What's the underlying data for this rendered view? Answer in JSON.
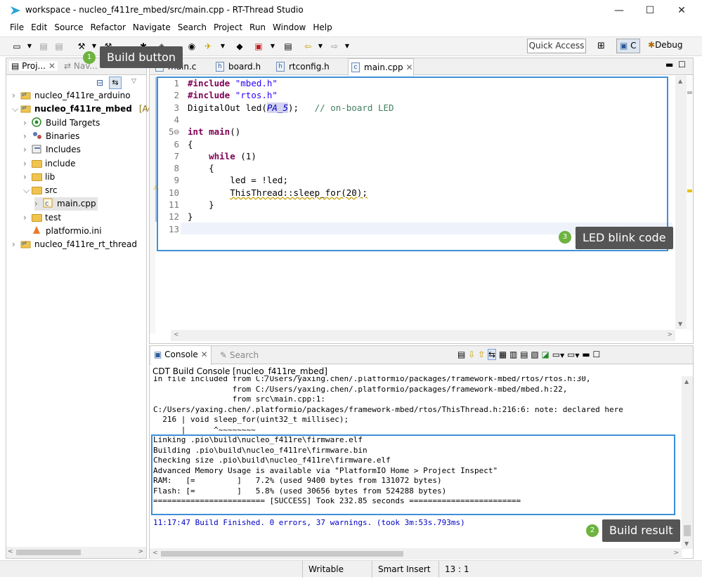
{
  "window": {
    "title": "workspace - nucleo_f411re_mbed/src/main.cpp - RT-Thread Studio",
    "minimize": "—",
    "maximize": "☐",
    "close": "✕"
  },
  "menu": [
    "File",
    "Edit",
    "Source",
    "Refactor",
    "Navigate",
    "Search",
    "Project",
    "Run",
    "Window",
    "Help"
  ],
  "toolbar": {
    "quick_access": "Quick Access",
    "perspective_c": "C",
    "perspective_debug": "Debug"
  },
  "left_panel": {
    "tab_project": "Proj...",
    "tab_navigator": "Nav...",
    "tree": [
      {
        "label": "nucleo_f411re_arduino",
        "level": 0,
        "expanded": false,
        "bold": false,
        "icon": "project-icon"
      },
      {
        "label": "nucleo_f411re_mbed",
        "level": 0,
        "expanded": true,
        "bold": true,
        "icon": "project-icon",
        "suffix": "[Ac"
      },
      {
        "label": "Build Targets",
        "level": 1,
        "expanded": false,
        "icon": "target-icon"
      },
      {
        "label": "Binaries",
        "level": 1,
        "expanded": false,
        "icon": "binaries-icon"
      },
      {
        "label": "Includes",
        "level": 1,
        "expanded": false,
        "icon": "includes-icon"
      },
      {
        "label": "include",
        "level": 1,
        "expanded": false,
        "icon": "folder-icon"
      },
      {
        "label": "lib",
        "level": 1,
        "expanded": false,
        "icon": "folder-icon"
      },
      {
        "label": "src",
        "level": 1,
        "expanded": true,
        "icon": "folder-icon"
      },
      {
        "label": "main.cpp",
        "level": 2,
        "expanded": false,
        "icon": "cpp-file-icon",
        "selected": true
      },
      {
        "label": "test",
        "level": 1,
        "expanded": false,
        "icon": "folder-icon"
      },
      {
        "label": "platformio.ini",
        "level": 1,
        "expanded": null,
        "icon": "ini-file-icon"
      },
      {
        "label": "nucleo_f411re_rt_thread",
        "level": 0,
        "expanded": false,
        "icon": "project-icon"
      }
    ]
  },
  "editor": {
    "tabs": [
      {
        "label": "main.c",
        "active": false
      },
      {
        "label": "board.h",
        "active": false
      },
      {
        "label": "rtconfig.h",
        "active": false
      },
      {
        "label": "main.cpp",
        "active": true
      }
    ],
    "lines": [
      {
        "n": "1",
        "html_parts": [
          [
            "kw",
            "#include"
          ],
          [
            "",
            " "
          ],
          [
            "str",
            "\"mbed.h\""
          ]
        ]
      },
      {
        "n": "2",
        "html_parts": [
          [
            "kw",
            "#include"
          ],
          [
            "",
            " "
          ],
          [
            "str",
            "\"rtos.h\""
          ]
        ]
      },
      {
        "n": "3",
        "html_parts": [
          [
            "",
            "DigitalOut led("
          ],
          [
            "macro",
            "PA_5"
          ],
          [
            "",
            ");   "
          ],
          [
            "cmt",
            "// on-board LED"
          ]
        ]
      },
      {
        "n": "4",
        "html_parts": []
      },
      {
        "n": "5⊖",
        "html_parts": [
          [
            "kw",
            "int"
          ],
          [
            "",
            " "
          ],
          [
            "kw",
            "main"
          ],
          [
            "",
            "()"
          ]
        ]
      },
      {
        "n": "6",
        "html_parts": [
          [
            "",
            "{"
          ]
        ]
      },
      {
        "n": "7",
        "html_parts": [
          [
            "",
            "    "
          ],
          [
            "kw",
            "while"
          ],
          [
            "",
            " (1)"
          ]
        ]
      },
      {
        "n": "8",
        "html_parts": [
          [
            "",
            "    {"
          ]
        ]
      },
      {
        "n": "9",
        "html_parts": [
          [
            "",
            "        led = !led;"
          ]
        ]
      },
      {
        "n": "10",
        "html_parts": [
          [
            "",
            "        "
          ],
          [
            "warn",
            "ThisThread::sleep_for(20);"
          ]
        ]
      },
      {
        "n": "11",
        "html_parts": [
          [
            "",
            "    }"
          ]
        ]
      },
      {
        "n": "12",
        "html_parts": [
          [
            "",
            "}"
          ]
        ]
      },
      {
        "n": "13",
        "html_parts": []
      }
    ]
  },
  "console": {
    "tab_console": "Console",
    "tab_search": "Search",
    "header": "CDT Build Console [nucleo_f411re_mbed]",
    "lines": [
      "In file included from C:/Users/yaxing.chen/.platformio/packages/framework-mbed/rtos/rtos.h:30,",
      "                 from C:/Users/yaxing.chen/.platformio/packages/framework-mbed/mbed.h:22,",
      "                 from src\\main.cpp:1:",
      "C:/Users/yaxing.chen/.platformio/packages/framework-mbed/rtos/ThisThread.h:216:6: note: declared here",
      "  216 | void sleep_for(uint32_t millisec);",
      "      |      ^~~~~~~~~",
      "Linking .pio\\build\\nucleo_f411re\\firmware.elf",
      "Building .pio\\build\\nucleo_f411re\\firmware.bin",
      "Checking size .pio\\build\\nucleo_f411re\\firmware.elf",
      "Advanced Memory Usage is available via \"PlatformIO Home > Project Inspect\"",
      "RAM:   [=         ]   7.2% (used 9400 bytes from 131072 bytes)",
      "Flash: [=         ]   5.8% (used 30656 bytes from 524288 bytes)",
      "======================== [SUCCESS] Took 232.85 seconds ========================"
    ],
    "finished": "11:17:47 Build Finished. 0 errors, 37 warnings. (took 3m:53s.793ms)"
  },
  "annotations": {
    "build_button": {
      "num": "1",
      "label": "Build button"
    },
    "build_result": {
      "num": "2",
      "label": "Build result"
    },
    "led_blink": {
      "num": "3",
      "label": "LED blink code"
    }
  },
  "status": {
    "writable": "Writable",
    "insert_mode": "Smart Insert",
    "position": "13 : 1"
  },
  "colors": {
    "accent_box": "#3d8fd8",
    "badge": "#6db33f",
    "callout_bg": "#555555"
  }
}
